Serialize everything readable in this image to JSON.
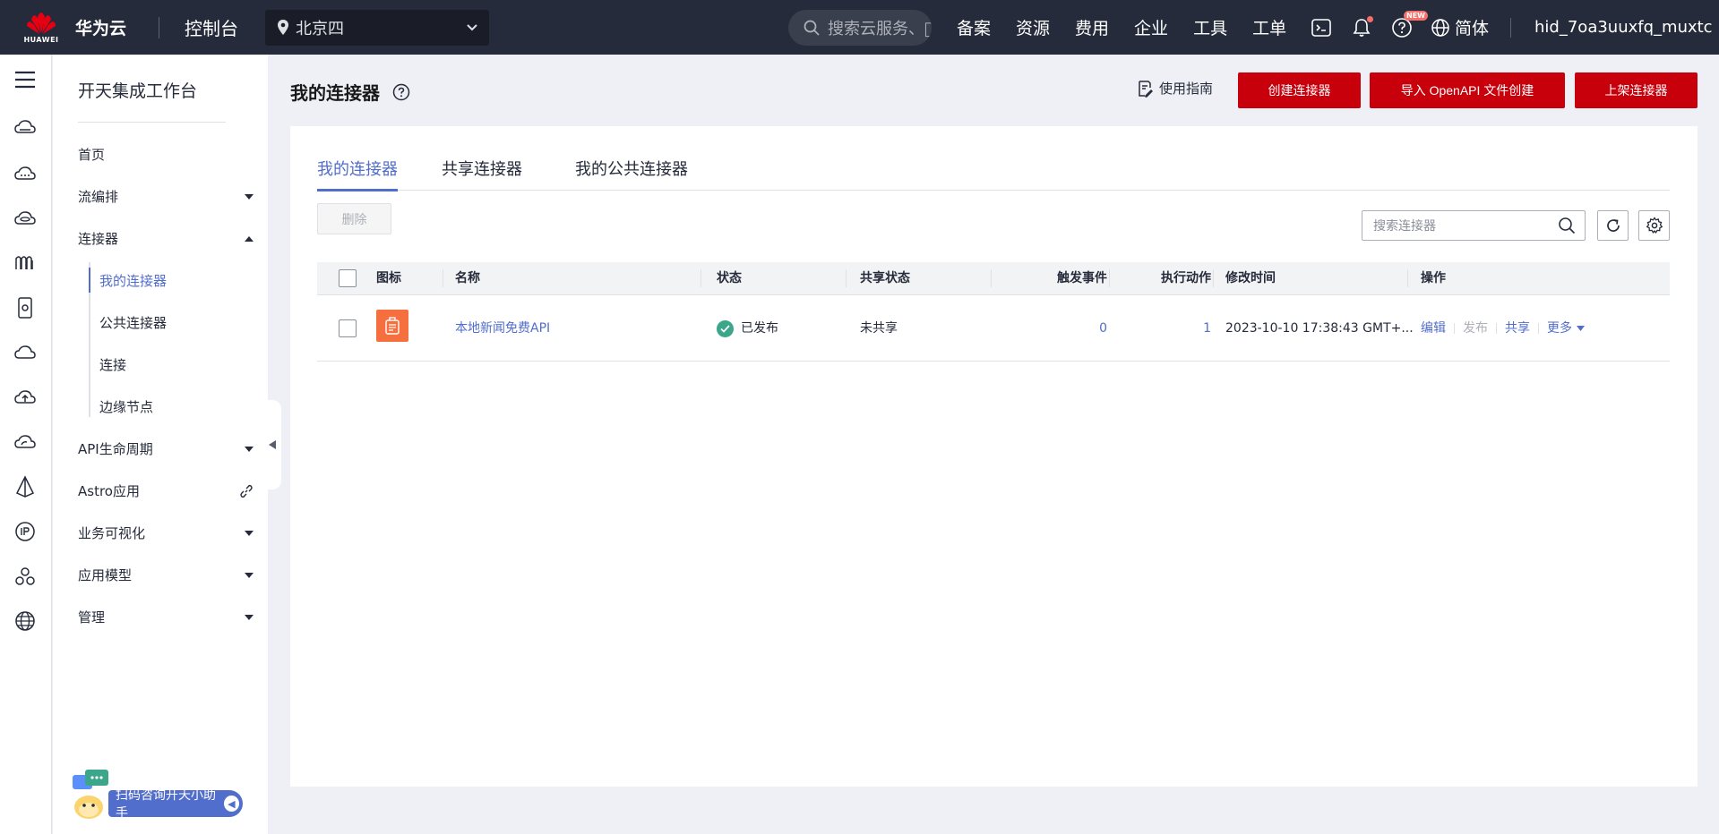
{
  "topbar": {
    "logo_word": "HUAWEI",
    "brand": "华为云",
    "console": "控制台",
    "region": "北京四",
    "search_placeholder": "搜索云服务、\u0000",
    "nav": [
      "备案",
      "资源",
      "费用",
      "企业",
      "工具",
      "工单"
    ],
    "new_badge": "NEW",
    "language": "简体",
    "username": "hid_7oa3uuxfq_muxtc"
  },
  "sidebar": {
    "title": "开天集成工作台",
    "items": [
      {
        "label": "首页"
      },
      {
        "label": "流编排"
      },
      {
        "label": "连接器"
      },
      {
        "label": "API生命周期"
      },
      {
        "label": "Astro应用"
      },
      {
        "label": "业务可视化"
      },
      {
        "label": "应用模型"
      },
      {
        "label": "管理"
      }
    ],
    "sub_items": [
      {
        "label": "我的连接器"
      },
      {
        "label": "公共连接器"
      },
      {
        "label": "连接"
      },
      {
        "label": "边缘节点"
      }
    ],
    "helper_text": "扫码咨询开天小助手"
  },
  "main": {
    "title": "我的连接器",
    "guide": "使用指南",
    "buttons": {
      "create": "创建连接器",
      "import": "导入 OpenAPI 文件创建",
      "publish": "上架连接器"
    },
    "tabs": [
      {
        "label": "我的连接器"
      },
      {
        "label": "共享连接器"
      },
      {
        "label": "我的公共连接器"
      }
    ],
    "delete": "删除",
    "search_placeholder": "搜索连接器",
    "table": {
      "headers": [
        "图标",
        "名称",
        "状态",
        "共享状态",
        "触发事件",
        "执行动作",
        "修改时间",
        "操作"
      ],
      "rows": [
        {
          "name": "本地新闻免费API",
          "status": "已发布",
          "share_status": "未共享",
          "trigger_events": "0",
          "actions": "1",
          "modified": "2023-10-10 17:38:43 GMT+...",
          "ops": {
            "edit": "编辑",
            "publish": "发布",
            "share": "共享",
            "more": "更多"
          }
        }
      ]
    }
  },
  "colors": {
    "topbar": "#252b3a",
    "accent": "#526ecc",
    "primary_button": "#c7000b",
    "success": "#3ba68a",
    "connector_icon": "#f66f3e"
  }
}
